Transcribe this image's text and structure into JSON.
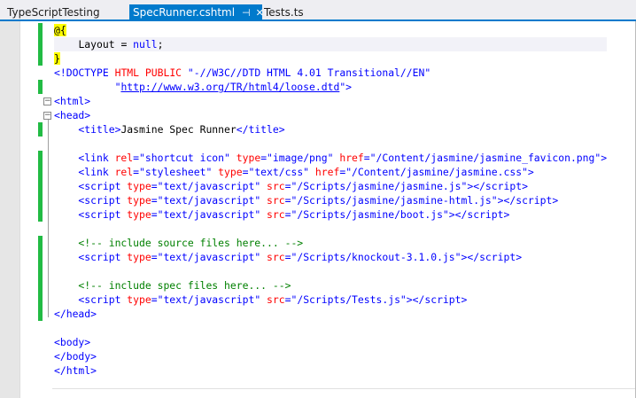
{
  "tabs": [
    {
      "label": "TypeScriptTesting",
      "active": false
    },
    {
      "label": "SpecRunner.cshtml",
      "active": true,
      "pin_icon": "⊣",
      "close_icon": "✕"
    },
    {
      "label": "Tests.ts",
      "active": false
    }
  ],
  "code_lines": [
    [
      [
        "@{",
        "r"
      ]
    ],
    [
      [
        "    ",
        "p"
      ],
      [
        "Layout = ",
        "p"
      ],
      [
        "null",
        "k"
      ],
      [
        ";",
        "p"
      ]
    ],
    [
      [
        "}",
        "r"
      ]
    ],
    [
      [
        "<!",
        "t"
      ],
      [
        "DOCTYPE ",
        "t"
      ],
      [
        "HTML PUBLIC ",
        "a"
      ],
      [
        "\"-//W3C//DTD HTML 4.01 Transitional//EN\"",
        "v"
      ]
    ],
    [
      [
        "          \"",
        "v"
      ],
      [
        "http://www.w3.org/TR/html4/loose.dtd",
        "u"
      ],
      [
        "\">",
        "v"
      ]
    ],
    [
      [
        "<",
        "t"
      ],
      [
        "html",
        "t"
      ],
      [
        ">",
        "t"
      ]
    ],
    [
      [
        "<",
        "t"
      ],
      [
        "head",
        "t"
      ],
      [
        ">",
        "t"
      ]
    ],
    [
      [
        "    <title>",
        "t"
      ],
      [
        "Jasmine Spec Runner",
        "p"
      ],
      [
        "</title>",
        "t"
      ]
    ],
    [],
    [
      [
        "    <link ",
        "t"
      ],
      [
        "rel",
        "a"
      ],
      [
        "=\"shortcut icon\" ",
        "v"
      ],
      [
        "type",
        "a"
      ],
      [
        "=\"image/png\" ",
        "v"
      ],
      [
        "href",
        "a"
      ],
      [
        "=\"/Content/jasmine/jasmine_favicon.png\">",
        "v"
      ]
    ],
    [
      [
        "    <link ",
        "t"
      ],
      [
        "rel",
        "a"
      ],
      [
        "=\"stylesheet\" ",
        "v"
      ],
      [
        "type",
        "a"
      ],
      [
        "=\"text/css\" ",
        "v"
      ],
      [
        "href",
        "a"
      ],
      [
        "=\"/Content/jasmine/jasmine.css\">",
        "v"
      ]
    ],
    [
      [
        "    <script ",
        "t"
      ],
      [
        "type",
        "a"
      ],
      [
        "=\"text/javascript\" ",
        "v"
      ],
      [
        "src",
        "a"
      ],
      [
        "=\"/Scripts/jasmine/jasmine.js\"></script>",
        "v"
      ]
    ],
    [
      [
        "    <script ",
        "t"
      ],
      [
        "type",
        "a"
      ],
      [
        "=\"text/javascript\" ",
        "v"
      ],
      [
        "src",
        "a"
      ],
      [
        "=\"/Scripts/jasmine/jasmine-html.js\"></script>",
        "v"
      ]
    ],
    [
      [
        "    <script ",
        "t"
      ],
      [
        "type",
        "a"
      ],
      [
        "=\"text/javascript\" ",
        "v"
      ],
      [
        "src",
        "a"
      ],
      [
        "=\"/Scripts/jasmine/boot.js\"></script>",
        "v"
      ]
    ],
    [],
    [
      [
        "    <!-- include source files here... -->",
        "c"
      ]
    ],
    [
      [
        "    <script ",
        "t"
      ],
      [
        "type",
        "a"
      ],
      [
        "=\"text/javascript\" ",
        "v"
      ],
      [
        "src",
        "a"
      ],
      [
        "=\"/Scripts/knockout-3.1.0.js\"></script>",
        "v"
      ]
    ],
    [],
    [
      [
        "    <!-- include spec files here... -->",
        "c"
      ]
    ],
    [
      [
        "    <script ",
        "t"
      ],
      [
        "type",
        "a"
      ],
      [
        "=\"text/javascript\" ",
        "v"
      ],
      [
        "src",
        "a"
      ],
      [
        "=\"/Scripts/Tests.js\"></script>",
        "v"
      ]
    ],
    [
      [
        "</head>",
        "t"
      ]
    ],
    [],
    [
      [
        "<body>",
        "t"
      ]
    ],
    [
      [
        "</body>",
        "t"
      ]
    ],
    [
      [
        "</html>",
        "t"
      ]
    ]
  ],
  "changed_lines": [
    0,
    1,
    2,
    4,
    7,
    9,
    10,
    11,
    12,
    13,
    15,
    16,
    17,
    18,
    19,
    20
  ],
  "fold_lines": [
    5,
    6
  ]
}
